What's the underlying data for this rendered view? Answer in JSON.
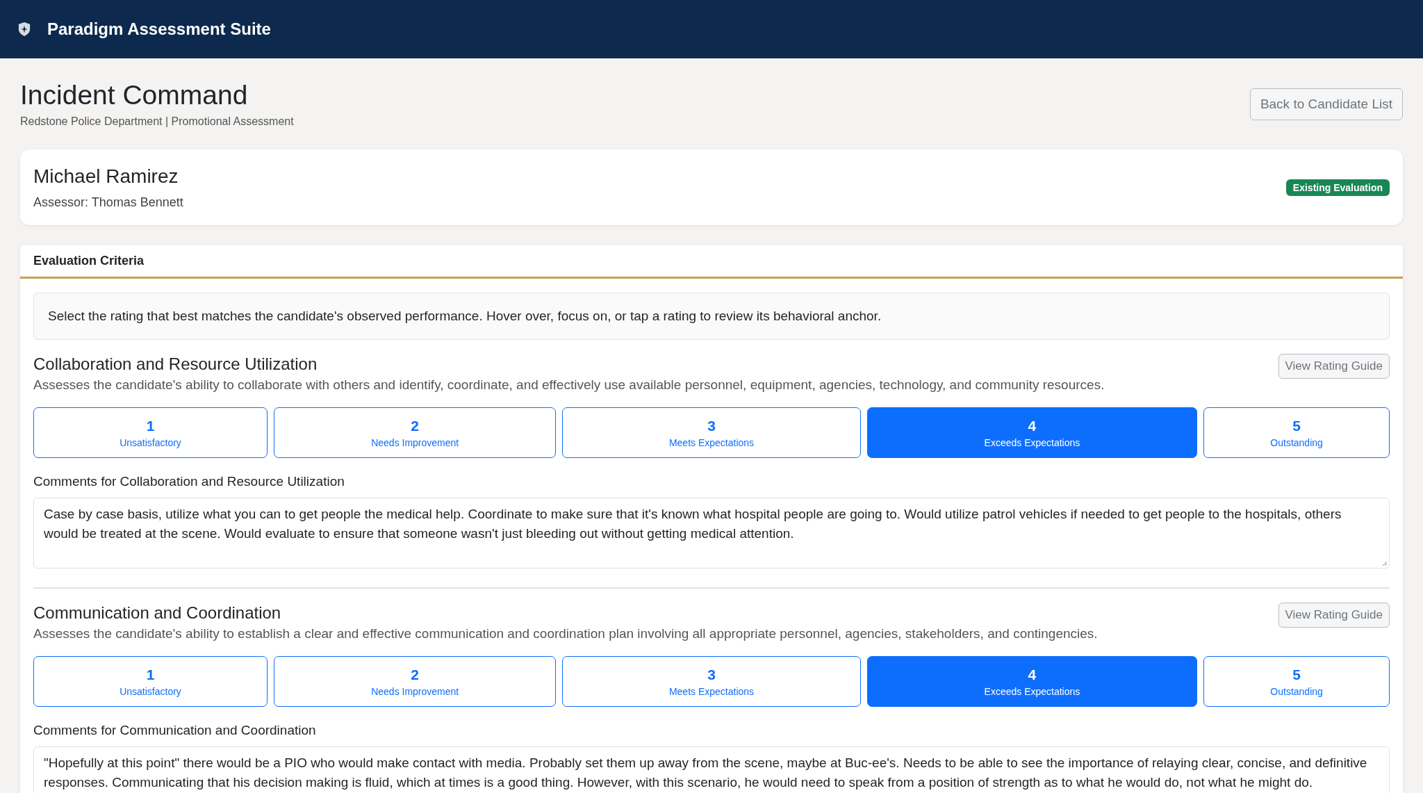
{
  "header": {
    "title": "Paradigm Assessment Suite"
  },
  "page": {
    "title": "Incident Command",
    "subtitle": "Redstone Police Department | Promotional Assessment",
    "back_button": "Back to Candidate List"
  },
  "candidate": {
    "name": "Michael Ramirez",
    "assessor": "Assessor: Thomas Bennett",
    "badge": "Existing Evaluation"
  },
  "evaluation": {
    "title": "Evaluation Criteria",
    "instructions": "Select the rating that best matches the candidate's observed performance. Hover over, focus on, or tap a rating to review its behavioral anchor.",
    "criteria": [
      {
        "title": "Collaboration and Resource Utilization",
        "description": "Assesses the candidate's ability to collaborate with others and identify, coordinate, and effectively use available personnel, equipment, agencies, technology, and community resources.",
        "guide_button": "View Rating Guide",
        "ratings": [
          {
            "value": "1",
            "label": "Unsatisfactory",
            "selected": false
          },
          {
            "value": "2",
            "label": "Needs Improvement",
            "selected": false
          },
          {
            "value": "3",
            "label": "Meets Expectations",
            "selected": false
          },
          {
            "value": "4",
            "label": "Exceeds Expectations",
            "selected": true
          },
          {
            "value": "5",
            "label": "Outstanding",
            "selected": false
          }
        ],
        "comments_label": "Comments for Collaboration and Resource Utilization",
        "comments": "Case by case basis, utilize what you can to get people the medical help. Coordinate to make sure that it's known what hospital people are going to. Would utilize patrol vehicles if needed to get people to the hospitals, others would be treated at the scene. Would evaluate to ensure that someone wasn't just bleeding out without getting medical attention."
      },
      {
        "title": "Communication and Coordination",
        "description": "Assesses the candidate's ability to establish a clear and effective communication and coordination plan involving all appropriate personnel, agencies, stakeholders, and contingencies.",
        "guide_button": "View Rating Guide",
        "ratings": [
          {
            "value": "1",
            "label": "Unsatisfactory",
            "selected": false
          },
          {
            "value": "2",
            "label": "Needs Improvement",
            "selected": false
          },
          {
            "value": "3",
            "label": "Meets Expectations",
            "selected": false
          },
          {
            "value": "4",
            "label": "Exceeds Expectations",
            "selected": true
          },
          {
            "value": "5",
            "label": "Outstanding",
            "selected": false
          }
        ],
        "comments_label": "Comments for Communication and Coordination",
        "comments": "\"Hopefully at this point\" there would be a PIO who would make contact with media. Probably set them up away from the scene, maybe at Buc-ee's. Needs to be able to see the importance of relaying clear, concise, and definitive responses. Communicating that his decision making is fluid, which at times is a good thing. However, with this scenario, he would need to speak from a position of strength as to what he would do, not what he might do."
      }
    ]
  }
}
